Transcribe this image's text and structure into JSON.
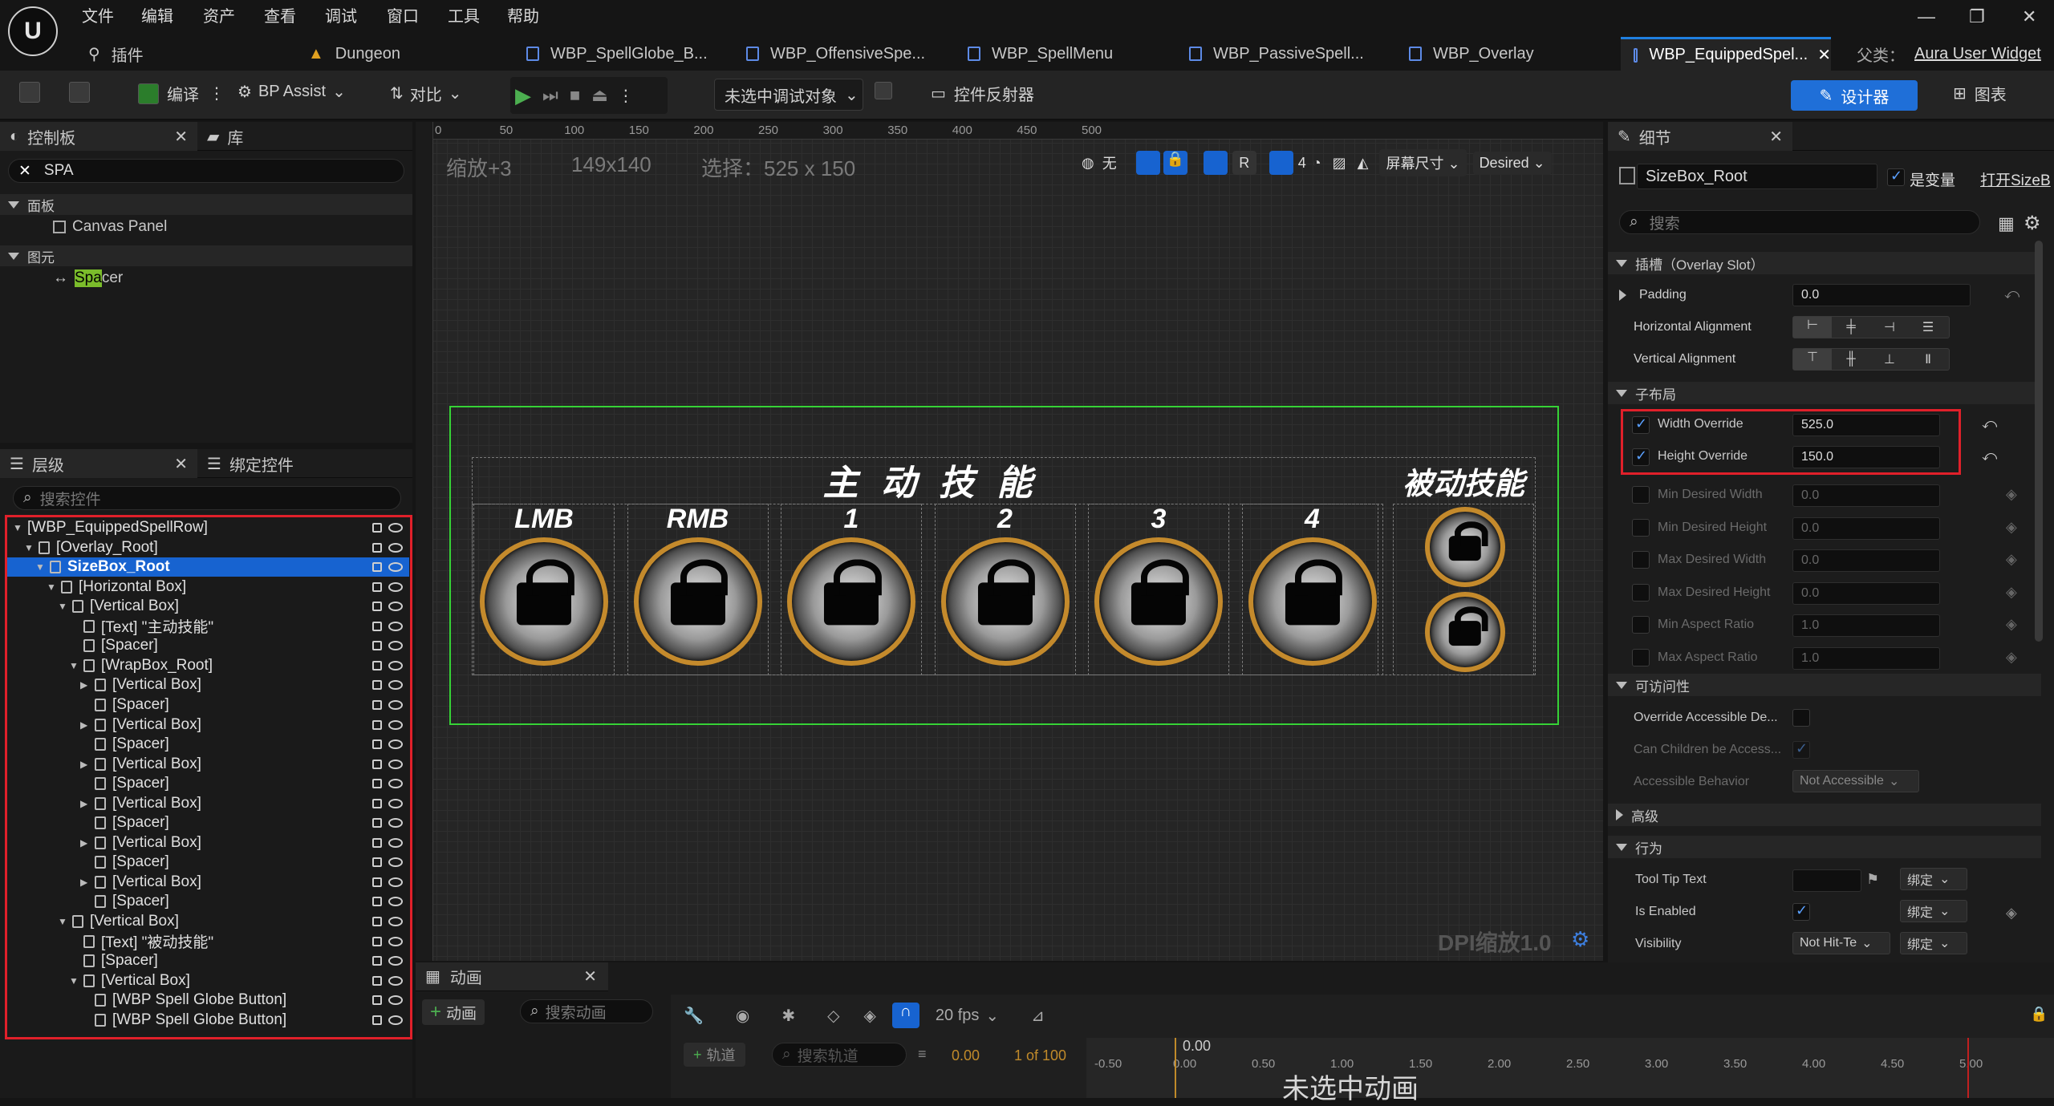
{
  "menu": [
    "文件",
    "编辑",
    "资产",
    "查看",
    "调试",
    "窗口",
    "工具",
    "帮助"
  ],
  "tabs": {
    "plugins": "插件",
    "items": [
      "Dungeon",
      "WBP_SpellGlobe_B...",
      "WBP_OffensiveSpe...",
      "WBP_SpellMenu",
      "WBP_PassiveSpell...",
      "WBP_Overlay",
      "WBP_EquippedSpel..."
    ],
    "parent_class_label": "父类：",
    "parent_class": "Aura User Widget"
  },
  "toolbar": {
    "compile": "编译",
    "bp_assist": "BP Assist",
    "diff": "对比",
    "debug_target": "未选中调试对象",
    "widget_reflector": "控件反射器",
    "designer": "设计器",
    "graph": "图表"
  },
  "palette": {
    "tab1": "控制板",
    "tab2": "库",
    "search": "SPA",
    "sec_panel": "面板",
    "canvas_panel": "Canvas Panel",
    "sec_primitive": "图元",
    "spacer_hl": "Spa",
    "spacer_rest": "cer"
  },
  "hierarchy": {
    "tab1": "层级",
    "tab2": "绑定控件",
    "search_placeholder": "搜索控件",
    "rows": [
      {
        "label": "[WBP_EquippedSpellRow]",
        "indent": 0
      },
      {
        "label": "[Overlay_Root]",
        "indent": 1
      },
      {
        "label": "SizeBox_Root",
        "indent": 2
      },
      {
        "label": "[Horizontal Box]",
        "indent": 3
      },
      {
        "label": "[Vertical Box]",
        "indent": 4
      },
      {
        "label": "[Text] \"主动技能\"",
        "indent": 5
      },
      {
        "label": "[Spacer]",
        "indent": 5
      },
      {
        "label": "[WrapBox_Root]",
        "indent": 5
      },
      {
        "label": "[Vertical Box]",
        "indent": 6
      },
      {
        "label": "[Spacer]",
        "indent": 6
      },
      {
        "label": "[Vertical Box]",
        "indent": 6
      },
      {
        "label": "[Spacer]",
        "indent": 6
      },
      {
        "label": "[Vertical Box]",
        "indent": 6
      },
      {
        "label": "[Spacer]",
        "indent": 6
      },
      {
        "label": "[Vertical Box]",
        "indent": 6
      },
      {
        "label": "[Spacer]",
        "indent": 6
      },
      {
        "label": "[Vertical Box]",
        "indent": 6
      },
      {
        "label": "[Spacer]",
        "indent": 6
      },
      {
        "label": "[Vertical Box]",
        "indent": 6
      },
      {
        "label": "[Spacer]",
        "indent": 6
      },
      {
        "label": "[Vertical Box]",
        "indent": 4
      },
      {
        "label": "[Text] \"被动技能\"",
        "indent": 5
      },
      {
        "label": "[Spacer]",
        "indent": 5
      },
      {
        "label": "[Vertical Box]",
        "indent": 5
      },
      {
        "label": "[WBP Spell Globe Button]",
        "indent": 6
      },
      {
        "label": "[WBP Spell Globe Button]",
        "indent": 6
      }
    ]
  },
  "viewport": {
    "zoom": "缩放+3",
    "size": "149x140",
    "selection": "选择：525 x 150",
    "none_label": "无",
    "r_label": "R",
    "grid_num": "4",
    "screen_size": "屏幕尺寸",
    "desired": "Desired",
    "dpi": "DPI缩放1.0",
    "ruler_h": [
      "0",
      "50",
      "100",
      "150",
      "200",
      "250",
      "300",
      "350",
      "400",
      "450",
      "500"
    ],
    "active_title": "主 动 技 能",
    "passive_title": "被动技能",
    "slots": [
      "LMB",
      "RMB",
      "1",
      "2",
      "3",
      "4"
    ]
  },
  "details": {
    "tab": "细节",
    "name": "SizeBox_Root",
    "is_variable": "是变量",
    "open_sizebox": "打开SizeB",
    "search_placeholder": "搜索",
    "sec_slot": "插槽（Overlay Slot）",
    "padding": "Padding",
    "padding_val": "0.0",
    "h_align": "Horizontal Alignment",
    "v_align": "Vertical Alignment",
    "sec_child_layout": "子布局",
    "width_override": "Width Override",
    "width_val": "525.0",
    "height_override": "Height Override",
    "height_val": "150.0",
    "min_w": "Min Desired Width",
    "min_w_val": "0.0",
    "min_h": "Min Desired Height",
    "min_h_val": "0.0",
    "max_w": "Max Desired Width",
    "max_w_val": "0.0",
    "max_h": "Max Desired Height",
    "max_h_val": "0.0",
    "min_ar": "Min Aspect Ratio",
    "min_ar_val": "1.0",
    "max_ar": "Max Aspect Ratio",
    "max_ar_val": "1.0",
    "sec_access": "可访问性",
    "override_access": "Override Accessible De...",
    "children_access": "Can Children be Access...",
    "access_behavior": "Accessible Behavior",
    "access_behavior_val": "Not Accessible",
    "sec_advanced": "高级",
    "sec_behavior": "行为",
    "tooltip": "Tool Tip Text",
    "bind": "绑定",
    "is_enabled": "Is Enabled",
    "visibility": "Visibility",
    "visibility_val": "Not Hit-Te"
  },
  "animation": {
    "tab": "动画",
    "add_anim": "动画",
    "search_anim": "搜索动画",
    "fps": "20 fps",
    "add_track": "轨道",
    "search_track": "搜索轨道",
    "time": "0.00",
    "frames": "1 of 100",
    "no_anim": "未选中动画",
    "ruler": [
      "-0.50",
      "0.00",
      "0.50",
      "1.00",
      "1.50",
      "2.00",
      "2.50",
      "3.00",
      "3.50",
      "4.00",
      "4.50",
      "5.00"
    ]
  },
  "colors": {
    "accent": "#1f6fd8",
    "selection_green": "#36d236",
    "highlight_red": "#e0202a",
    "globe_rim": "#c48a2c"
  }
}
